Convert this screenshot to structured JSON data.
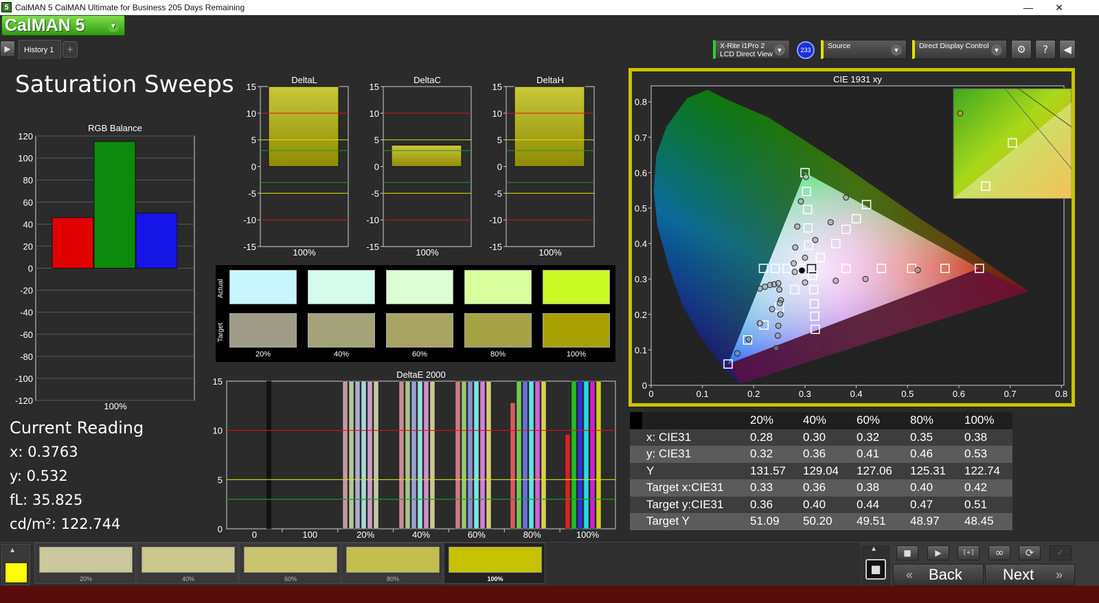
{
  "window": {
    "title": "CalMAN 5 CalMAN Ultimate for Business 205 Days Remaining",
    "minimize": "—",
    "restore": "❐",
    "close": "✕"
  },
  "logo": {
    "text": "CalMAN 5",
    "dropdown_icon": "chevron-down-icon"
  },
  "tabs": [
    {
      "label": "History 1"
    }
  ],
  "tab_add": "+",
  "toolbar": {
    "meter": {
      "line1": "X-Rite i1Pro 2",
      "line2": "LCD Direct View",
      "badge": "233",
      "accent": "#2bd12b"
    },
    "source": {
      "label": "Source",
      "accent": "#e0e000"
    },
    "display": {
      "label": "Direct Display Control",
      "accent": "#e0e000"
    },
    "settings_icon": "⚙",
    "help_icon": "?",
    "collapse_icon": "◀"
  },
  "page_title": "Saturation Sweeps",
  "rgb_balance": {
    "title": "RGB Balance",
    "ylim": [
      -120,
      120
    ],
    "ticks": [
      "120",
      "100",
      "80",
      "60",
      "40",
      "20",
      "0",
      "-20",
      "-40",
      "-60",
      "-80",
      "-100",
      "-120"
    ],
    "tick_values": [
      120,
      100,
      80,
      60,
      40,
      20,
      0,
      -20,
      -40,
      -60,
      -80,
      -100,
      -120
    ],
    "xlabel": "100%",
    "bars": [
      {
        "name": "R",
        "value": 46,
        "color": "#e00000"
      },
      {
        "name": "G",
        "value": 115,
        "color": "#0b8a0b"
      },
      {
        "name": "B",
        "value": 50,
        "color": "#1515e6"
      }
    ]
  },
  "delta_charts": [
    {
      "title": "DeltaL",
      "value": 15,
      "bar_start": 0,
      "xlabel": "100%"
    },
    {
      "title": "DeltaC",
      "value": 4,
      "bar_start": 0,
      "xlabel": "100%"
    },
    {
      "title": "DeltaH",
      "value": 15,
      "bar_start": 0,
      "xlabel": "100%"
    }
  ],
  "delta_ticks": [
    "15",
    "10",
    "5",
    "0",
    "-5",
    "-10",
    "-15"
  ],
  "delta_tick_values": [
    15,
    10,
    5,
    0,
    -5,
    -10,
    -15
  ],
  "swatches": {
    "row_labels": {
      "actual": "Actual",
      "target": "Target"
    },
    "items": [
      {
        "label": "20%",
        "actual": "#c8f6ff",
        "target": "#9e9c86"
      },
      {
        "label": "40%",
        "actual": "#d4fbec",
        "target": "#a4a278"
      },
      {
        "label": "60%",
        "actual": "#dcffd4",
        "target": "#a8a462"
      },
      {
        "label": "80%",
        "actual": "#d8ff9c",
        "target": "#a6a246"
      },
      {
        "label": "100%",
        "actual": "#c9fa22",
        "target": "#a8a000"
      }
    ]
  },
  "current_reading": {
    "heading": "Current Reading",
    "x": "x: 0.3763",
    "y": "y: 0.532",
    "fL": "fL: 35.825",
    "cdm2": "cd/m²: 122.744"
  },
  "chart_data": [
    {
      "type": "bar",
      "title": "RGB Balance",
      "categories": [
        "R",
        "G",
        "B"
      ],
      "values": [
        46,
        115,
        50
      ],
      "ylim": [
        -120,
        120
      ],
      "xlabel": "100%"
    },
    {
      "type": "bar",
      "title": "DeltaL",
      "categories": [
        "100%"
      ],
      "values": [
        15
      ],
      "ylim": [
        -15,
        15
      ]
    },
    {
      "type": "bar",
      "title": "DeltaC",
      "categories": [
        "100%"
      ],
      "values": [
        4
      ],
      "ylim": [
        -15,
        15
      ]
    },
    {
      "type": "bar",
      "title": "DeltaH",
      "categories": [
        "100%"
      ],
      "values": [
        15
      ],
      "ylim": [
        -15,
        15
      ]
    },
    {
      "type": "bar",
      "title": "DeltaE 2000",
      "ylim": [
        0,
        15
      ],
      "x_ticks": [
        "0",
        "100",
        "20%",
        "40%",
        "60%",
        "80%",
        "100%"
      ],
      "groups": [
        {
          "label": "0",
          "bars": [
            {
              "value": 15,
              "color": "#111111"
            }
          ]
        },
        {
          "label": "20%",
          "bars": [
            {
              "value": 15,
              "color": "#c49aa0"
            },
            {
              "value": 15,
              "color": "#b5c59c"
            },
            {
              "value": 15,
              "color": "#a9b1c9"
            },
            {
              "value": 15,
              "color": "#a9d8db"
            },
            {
              "value": 15,
              "color": "#caa1cc"
            },
            {
              "value": 15,
              "color": "#c8c6a0"
            }
          ]
        },
        {
          "label": "40%",
          "bars": [
            {
              "value": 15,
              "color": "#c88d94"
            },
            {
              "value": 15,
              "color": "#a8c58a"
            },
            {
              "value": 15,
              "color": "#9aa0d0"
            },
            {
              "value": 15,
              "color": "#98dede"
            },
            {
              "value": 15,
              "color": "#cf92d2"
            },
            {
              "value": 15,
              "color": "#cbc990"
            }
          ]
        },
        {
          "label": "60%",
          "bars": [
            {
              "value": 15,
              "color": "#cf7a82"
            },
            {
              "value": 15,
              "color": "#96c976"
            },
            {
              "value": 15,
              "color": "#8a8fd8"
            },
            {
              "value": 15,
              "color": "#82e3e3"
            },
            {
              "value": 15,
              "color": "#d480d8"
            },
            {
              "value": 15,
              "color": "#d1ce78"
            }
          ]
        },
        {
          "label": "80%",
          "bars": [
            {
              "value": 12.8,
              "color": "#d85a62"
            },
            {
              "value": 15,
              "color": "#6fcb52"
            },
            {
              "value": 15,
              "color": "#6b70dc"
            },
            {
              "value": 15,
              "color": "#5fe6e6"
            },
            {
              "value": 15,
              "color": "#d65ed9"
            },
            {
              "value": 15,
              "color": "#d6d256"
            }
          ]
        },
        {
          "label": "100%",
          "bars": [
            {
              "value": 9.6,
              "color": "#dd2020"
            },
            {
              "value": 15,
              "color": "#20c020"
            },
            {
              "value": 15,
              "color": "#3030dd"
            },
            {
              "value": 15,
              "color": "#20e0e0"
            },
            {
              "value": 15,
              "color": "#d020d0"
            },
            {
              "value": 15,
              "color": "#d0d020"
            }
          ]
        }
      ],
      "thresholds": [
        {
          "value": 10,
          "color": "#e01010"
        },
        {
          "value": 5,
          "color": "#e0e000"
        },
        {
          "value": 3,
          "color": "#1a9a1a"
        }
      ]
    },
    {
      "type": "scatter",
      "title": "CIE 1931 xy",
      "xlim": [
        0,
        0.8
      ],
      "ylim": [
        0,
        0.85
      ],
      "x_ticks": [
        "0",
        "0.1",
        "0.2",
        "0.3",
        "0.4",
        "0.5",
        "0.6",
        "0.7",
        "0.8"
      ],
      "y_ticks": [
        "0",
        "0.1",
        "0.2",
        "0.3",
        "0.4",
        "0.5",
        "0.6",
        "0.7",
        "0.8"
      ],
      "gamut_red": [
        0.64,
        0.33
      ],
      "gamut_green": [
        0.3,
        0.6
      ],
      "gamut_blue": [
        0.15,
        0.06
      ],
      "white": [
        0.3127,
        0.329
      ],
      "targets": [
        [
          0.33,
          0.36
        ],
        [
          0.36,
          0.4
        ],
        [
          0.38,
          0.44
        ],
        [
          0.4,
          0.47
        ],
        [
          0.42,
          0.51
        ],
        [
          0.3,
          0.6
        ],
        [
          0.303,
          0.547
        ],
        [
          0.305,
          0.496
        ],
        [
          0.306,
          0.444
        ],
        [
          0.307,
          0.395
        ],
        [
          0.3127,
          0.329
        ],
        [
          0.15,
          0.06
        ],
        [
          0.188,
          0.128
        ],
        [
          0.22,
          0.17
        ],
        [
          0.25,
          0.22
        ],
        [
          0.28,
          0.27
        ],
        [
          0.64,
          0.33
        ],
        [
          0.573,
          0.33
        ],
        [
          0.508,
          0.33
        ],
        [
          0.449,
          0.33
        ],
        [
          0.38,
          0.33
        ],
        [
          0.219,
          0.33
        ],
        [
          0.242,
          0.33
        ],
        [
          0.265,
          0.33
        ],
        [
          0.289,
          0.33
        ],
        [
          0.315,
          0.31
        ],
        [
          0.317,
          0.27
        ],
        [
          0.318,
          0.23
        ],
        [
          0.319,
          0.195
        ],
        [
          0.32,
          0.158
        ]
      ],
      "measured": [
        [
          0.28,
          0.32
        ],
        [
          0.3,
          0.36
        ],
        [
          0.32,
          0.41
        ],
        [
          0.35,
          0.46
        ],
        [
          0.38,
          0.53
        ],
        [
          0.302,
          0.588
        ],
        [
          0.292,
          0.519
        ],
        [
          0.285,
          0.448
        ],
        [
          0.281,
          0.389
        ],
        [
          0.278,
          0.344
        ],
        [
          0.168,
          0.09
        ],
        [
          0.19,
          0.13
        ],
        [
          0.212,
          0.175
        ],
        [
          0.236,
          0.215
        ],
        [
          0.253,
          0.24
        ],
        [
          0.52,
          0.325
        ],
        [
          0.418,
          0.3
        ],
        [
          0.36,
          0.295
        ],
        [
          0.3,
          0.29
        ],
        [
          0.212,
          0.273
        ],
        [
          0.222,
          0.278
        ],
        [
          0.232,
          0.283
        ],
        [
          0.24,
          0.285
        ],
        [
          0.248,
          0.288
        ],
        [
          0.25,
          0.27
        ],
        [
          0.251,
          0.232
        ],
        [
          0.252,
          0.2
        ],
        [
          0.248,
          0.168
        ],
        [
          0.247,
          0.14
        ],
        [
          0.244,
          0.105
        ],
        [
          0.294,
          0.324
        ]
      ]
    }
  ],
  "deltae": {
    "title": "DeltaE 2000",
    "ticks": [
      "15",
      "10",
      "5",
      "0"
    ],
    "tick_values": [
      15,
      10,
      5,
      0
    ],
    "x_ticks": [
      "0",
      "100",
      "20%",
      "40%",
      "60%",
      "80%",
      "100%"
    ]
  },
  "cie": {
    "title": "CIE 1931 xy",
    "x_ticks": [
      "0",
      "0.1",
      "0.2",
      "0.3",
      "0.4",
      "0.5",
      "0.6",
      "0.7",
      "0.8"
    ],
    "y_ticks": [
      "0",
      "0.1",
      "0.2",
      "0.3",
      "0.4",
      "0.5",
      "0.6",
      "0.7",
      "0.8"
    ]
  },
  "table": {
    "headers": [
      "",
      "20%",
      "40%",
      "60%",
      "80%",
      "100%"
    ],
    "rows": [
      {
        "label": "x: CIE31",
        "values": [
          "0.28",
          "0.30",
          "0.32",
          "0.35",
          "0.38"
        ]
      },
      {
        "label": "y: CIE31",
        "values": [
          "0.32",
          "0.36",
          "0.41",
          "0.46",
          "0.53"
        ]
      },
      {
        "label": "Y",
        "values": [
          "131.57",
          "129.04",
          "127.06",
          "125.31",
          "122.74"
        ]
      },
      {
        "label": "Target x:CIE31",
        "values": [
          "0.33",
          "0.36",
          "0.38",
          "0.40",
          "0.42"
        ]
      },
      {
        "label": "Target y:CIE31",
        "values": [
          "0.36",
          "0.40",
          "0.44",
          "0.47",
          "0.51"
        ]
      },
      {
        "label": "Target Y",
        "values": [
          "51.09",
          "50.20",
          "49.51",
          "48.97",
          "48.45"
        ]
      }
    ]
  },
  "bottom_swatches": [
    {
      "label": "20%",
      "color": "#c9c79b"
    },
    {
      "label": "40%",
      "color": "#c9c78a"
    },
    {
      "label": "60%",
      "color": "#c8c56d"
    },
    {
      "label": "80%",
      "color": "#c2bf4e"
    },
    {
      "label": "100%",
      "color": "#c6c200"
    }
  ],
  "current_swatch_color": "#ffff00",
  "nav": {
    "back": "Back",
    "next": "Next",
    "stop_icon": "■",
    "play_icon": "▶",
    "bracket_icon": "[+]",
    "loop_icon": "∞",
    "refresh_icon": "⟳",
    "check_icon": "✓",
    "up_icon": "▲",
    "back_icon": "«",
    "next_icon": "»"
  }
}
